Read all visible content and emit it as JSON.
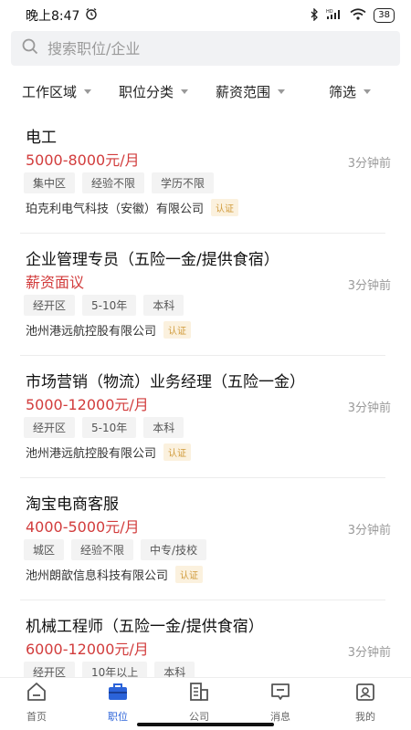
{
  "status_bar": {
    "time": "晚上8:47",
    "battery": "38",
    "network": "HD"
  },
  "search": {
    "placeholder": "搜索职位/企业"
  },
  "filters": [
    {
      "label": "工作区域"
    },
    {
      "label": "职位分类"
    },
    {
      "label": "薪资范围"
    },
    {
      "label": "筛选"
    }
  ],
  "jobs": [
    {
      "title": "电工",
      "salary": "5000-8000元/月",
      "time": "3分钟前",
      "tags": [
        "集中区",
        "经验不限",
        "学历不限"
      ],
      "company": "珀克利电气科技（安徽）有限公司",
      "badge": "认证"
    },
    {
      "title": "企业管理专员（五险一金/提供食宿）",
      "salary": "薪资面议",
      "time": "3分钟前",
      "tags": [
        "经开区",
        "5-10年",
        "本科"
      ],
      "company": "池州港远航控股有限公司",
      "badge": "认证"
    },
    {
      "title": "市场营销（物流）业务经理（五险一金）",
      "salary": "5000-12000元/月",
      "time": "3分钟前",
      "tags": [
        "经开区",
        "5-10年",
        "本科"
      ],
      "company": "池州港远航控股有限公司",
      "badge": "认证"
    },
    {
      "title": "淘宝电商客服",
      "salary": "4000-5000元/月",
      "time": "3分钟前",
      "tags": [
        "城区",
        "经验不限",
        "中专/技校"
      ],
      "company": "池州朗歆信息科技有限公司",
      "badge": "认证"
    },
    {
      "title": "机械工程师（五险一金/提供食宿）",
      "salary": "6000-12000元/月",
      "time": "3分钟前",
      "tags": [
        "经开区",
        "10年以上",
        "本科"
      ],
      "company": "",
      "badge": ""
    }
  ],
  "tabbar": [
    {
      "label": "首页",
      "icon": "home-icon"
    },
    {
      "label": "职位",
      "icon": "briefcase-icon",
      "active": true
    },
    {
      "label": "公司",
      "icon": "building-icon"
    },
    {
      "label": "消息",
      "icon": "message-icon"
    },
    {
      "label": "我的",
      "icon": "profile-icon"
    }
  ],
  "colors": {
    "salary": "#d23c3c",
    "accent": "#2b63d9",
    "badge_text": "#d09a3a",
    "badge_bg": "#fbf1de"
  }
}
